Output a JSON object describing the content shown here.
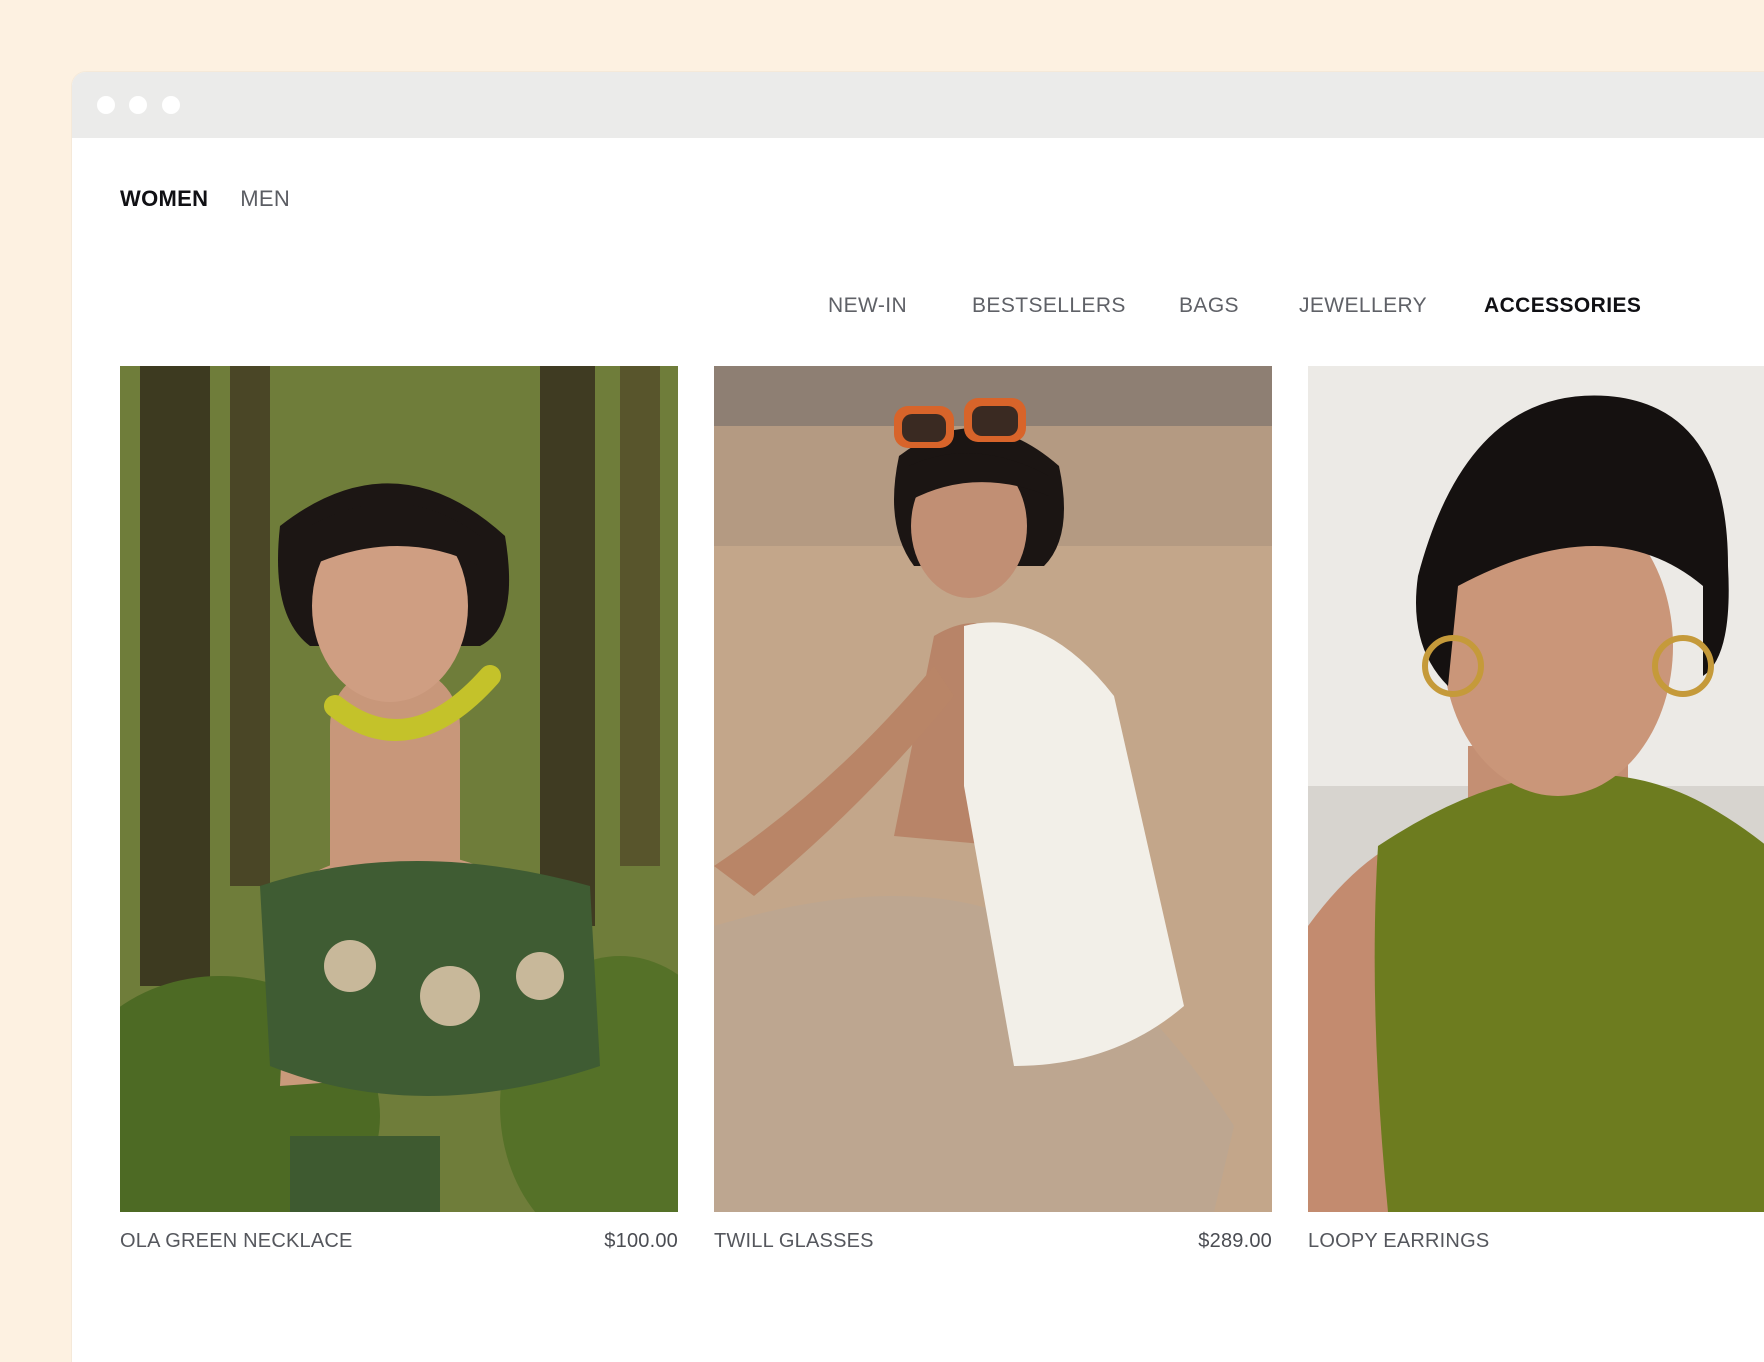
{
  "browser": {
    "window_dots": [
      "close",
      "minimize",
      "maximize"
    ]
  },
  "gender_nav": {
    "women": "WOMEN",
    "men": "MEN",
    "active": "WOMEN"
  },
  "category_nav": {
    "items": [
      "NEW-IN",
      "BESTSELLERS",
      "BAGS",
      "JEWELLERY",
      "ACCESSORIES"
    ],
    "active": "ACCESSORIES"
  },
  "products": [
    {
      "name": "OLA GREEN NECKLACE",
      "price": "$100.00"
    },
    {
      "name": "TWILL GLASSES",
      "price": "$289.00"
    },
    {
      "name": "LOOPY EARRINGS",
      "price": ""
    }
  ],
  "colors": {
    "page_bg": "#fdf1e1",
    "titlebar": "#ebebea",
    "active_text": "#101014",
    "muted_text": "#5f6167"
  }
}
